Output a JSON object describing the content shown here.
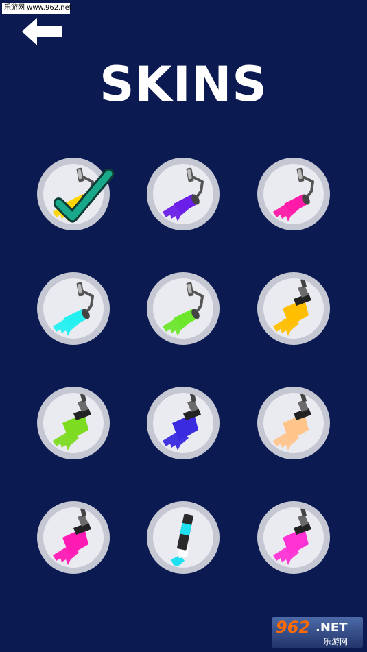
{
  "watermark_top": "乐游网 www.962.net",
  "back_button": {
    "icon": "arrow-left-icon"
  },
  "title": "SKINS",
  "selected_index": 0,
  "skins": [
    {
      "type": "roller",
      "color": "#ffd500",
      "selected": true
    },
    {
      "type": "roller",
      "color": "#6a1ee8",
      "selected": false
    },
    {
      "type": "roller",
      "color": "#ff1aa8",
      "selected": false
    },
    {
      "type": "roller",
      "color": "#25f0f0",
      "selected": false
    },
    {
      "type": "roller",
      "color": "#6ee62c",
      "selected": false
    },
    {
      "type": "brush",
      "color": "#ffbf00",
      "selected": false
    },
    {
      "type": "brush",
      "color": "#7ddb20",
      "selected": false
    },
    {
      "type": "brush",
      "color": "#3a2ae0",
      "selected": false
    },
    {
      "type": "brush",
      "color": "#ffc48a",
      "selected": false
    },
    {
      "type": "brush",
      "color": "#ff1ab4",
      "selected": false
    },
    {
      "type": "tube",
      "color": "#1ee0f0",
      "selected": false
    },
    {
      "type": "brush",
      "color": "#ff33d4",
      "selected": false
    }
  ],
  "colors": {
    "background": "#0b1b52",
    "slot_ring": "#c5c8d3",
    "slot_fill": "#eaebf0",
    "check": "#1aa88a"
  },
  "watermark_bottom": {
    "brand": "962",
    "net": ".NET",
    "sub": "乐游网"
  }
}
